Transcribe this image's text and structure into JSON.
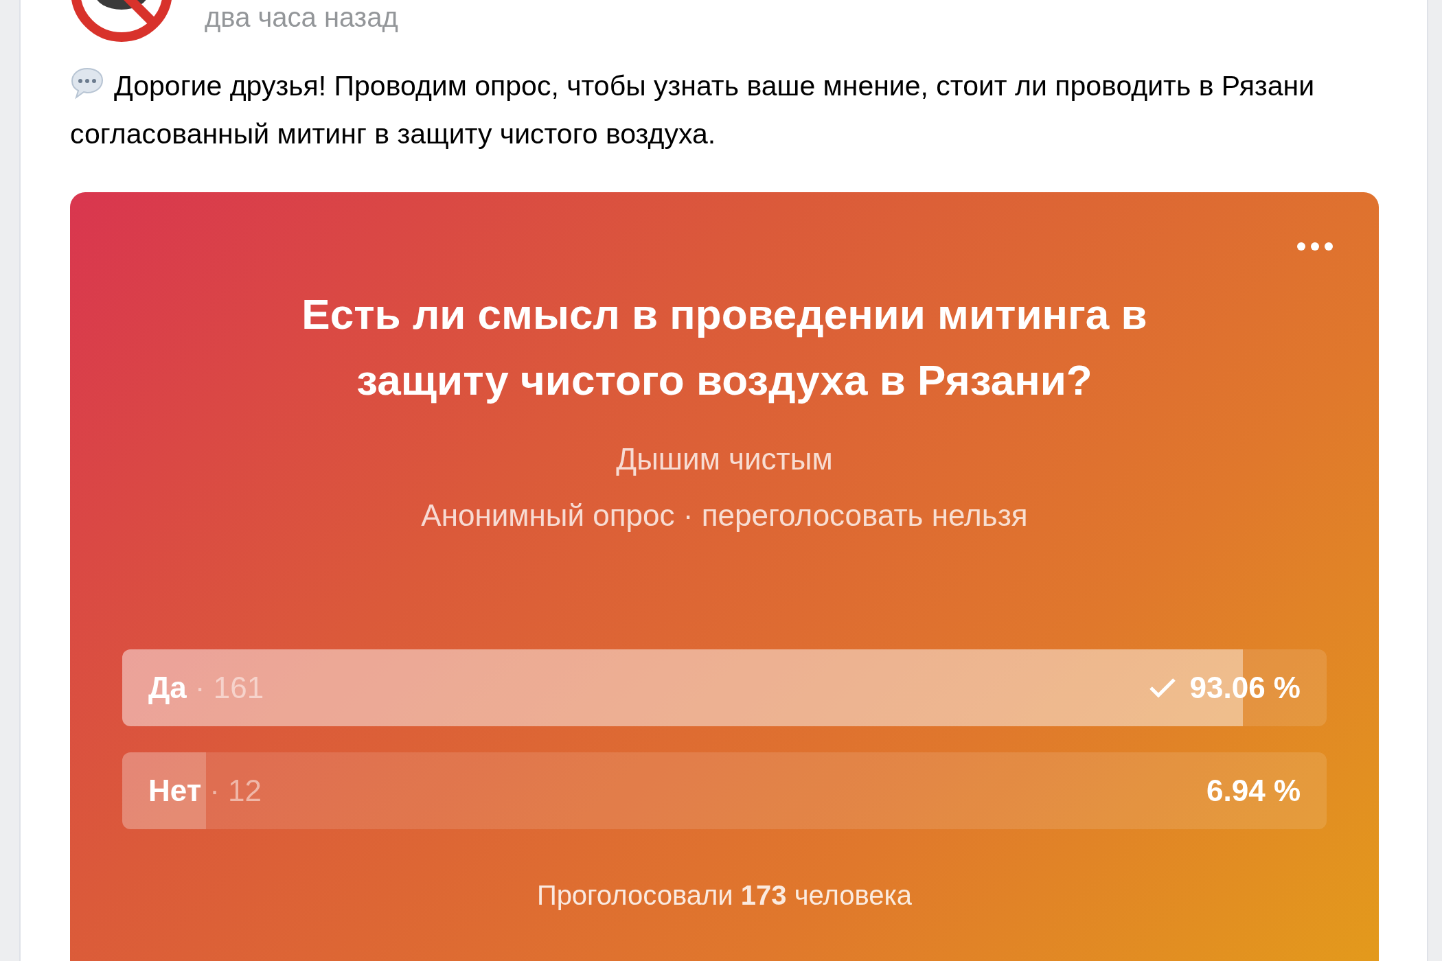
{
  "post": {
    "time": "два часа назад",
    "text": "Дорогие друзья! Проводим опрос, чтобы узнать ваше мнение, стоит ли проводить в Рязани согласованный митинг в защиту чистого воздуха."
  },
  "poll": {
    "title": "Есть ли смысл в проведении митинга в защиту чистого воздуха в Рязани?",
    "author": "Дышим чистым",
    "meta": "Анонимный опрос · переголосовать нельзя",
    "options": [
      {
        "label": "Да",
        "count": "· 161",
        "percent": "93.06 %",
        "level": 0.9306,
        "chosen": true
      },
      {
        "label": "Нет",
        "count": "· 12",
        "percent": "6.94 %",
        "level": 0.0694,
        "chosen": false
      }
    ],
    "total": "Проголосовали **173** человека"
  }
}
